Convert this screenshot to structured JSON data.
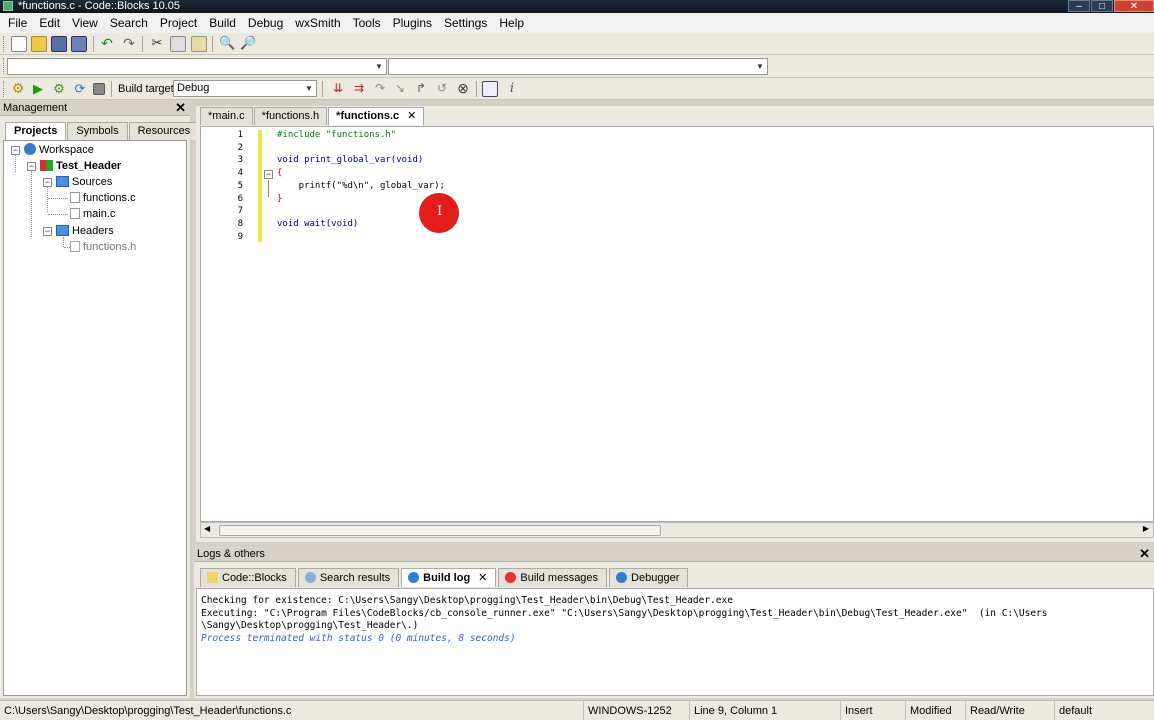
{
  "window": {
    "title": "*functions.c - Code::Blocks 10.05"
  },
  "menu": [
    "File",
    "Edit",
    "View",
    "Search",
    "Project",
    "Build",
    "Debug",
    "wxSmith",
    "Tools",
    "Plugins",
    "Settings",
    "Help"
  ],
  "toolbar": {
    "build_target_label": "Build target:",
    "build_target_value": "Debug"
  },
  "management": {
    "title": "Management",
    "tabs": [
      "Projects",
      "Symbols",
      "Resources"
    ],
    "tree": {
      "workspace": "Workspace",
      "project": "Test_Header",
      "sources": "Sources",
      "source_files": [
        "functions.c",
        "main.c"
      ],
      "headers": "Headers",
      "header_files": [
        "functions.h"
      ]
    }
  },
  "editor": {
    "tabs": [
      "*main.c",
      "*functions.h",
      "*functions.c"
    ],
    "line_numbers": [
      "1",
      "2",
      "3",
      "4",
      "5",
      "6",
      "7",
      "8",
      "9"
    ],
    "lines": [
      "#include \"functions.h\"",
      "",
      "void print_global_var(void)",
      "{",
      "    printf(\"%d\\n\", global_var);",
      "}",
      "",
      "void wait(void)",
      ""
    ]
  },
  "logs": {
    "title": "Logs & others",
    "tabs": [
      "Code::Blocks",
      "Search results",
      "Build log",
      "Build messages",
      "Debugger"
    ],
    "lines": [
      "Checking for existence: C:\\Users\\Sangy\\Desktop\\progging\\Test_Header\\bin\\Debug\\Test_Header.exe",
      "Executing: \"C:\\Program Files\\CodeBlocks/cb_console_runner.exe\" \"C:\\Users\\Sangy\\Desktop\\progging\\Test_Header\\bin\\Debug\\Test_Header.exe\"  (in C:\\Users",
      "\\Sangy\\Desktop\\progging\\Test_Header\\.)",
      "Process terminated with status 0 (0 minutes, 8 seconds)"
    ]
  },
  "status": {
    "path": "C:\\Users\\Sangy\\Desktop\\progging\\Test_Header\\functions.c",
    "encoding": "WINDOWS-1252",
    "position": "Line 9, Column 1",
    "mode": "Insert",
    "modified": "Modified",
    "access": "Read/Write",
    "lang": "default"
  },
  "colors": {
    "keyword": "#0000a0",
    "string": "#0000ff",
    "preproc": "#008000",
    "process_msg": "#3a5fcd",
    "cursor_highlight": "#e31c1c"
  }
}
